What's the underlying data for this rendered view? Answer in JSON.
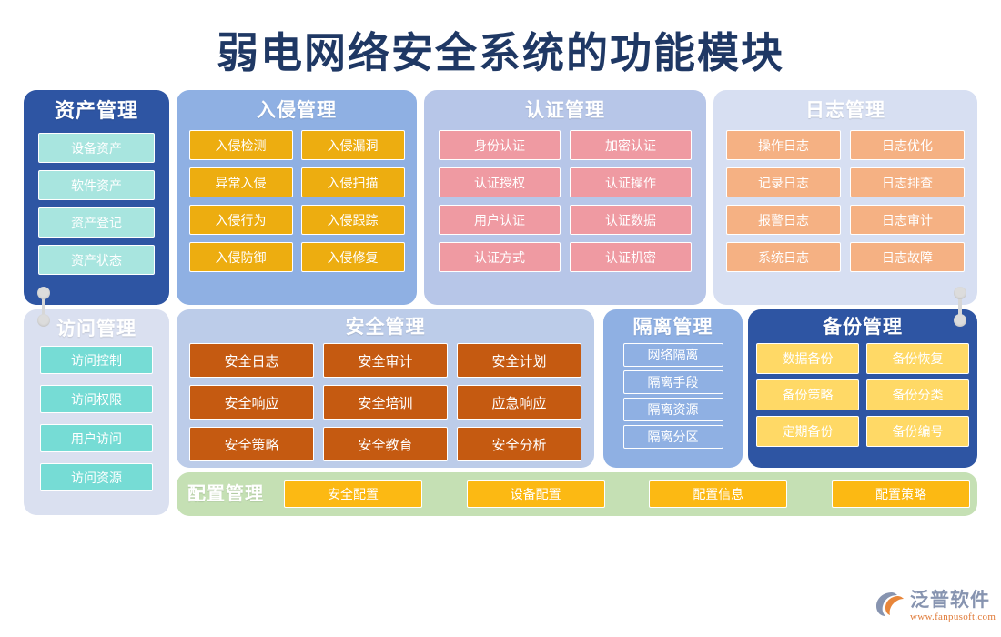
{
  "title": "弱电网络安全系统的功能模块",
  "colors": {
    "title_text": "#1f3864",
    "panel_dark_blue": "#2e55a3",
    "panel_medium_blue": "#8fb0e3",
    "panel_light_blue": "#b7c6e8",
    "panel_pale_blue": "#d7dff2",
    "panel_lavender": "#dae0f0",
    "panel_soft_blue": "#bccce9",
    "panel_green": "#c5e0b4",
    "item_teal_pale": "#a8e5df",
    "item_gold": "#edad10",
    "item_pink": "#ef9aa2",
    "item_orange": "#f5b183",
    "item_turquoise": "#76dcd5",
    "item_brown_orange": "#c55a11",
    "item_yellow": "#ffd966",
    "item_amber": "#fcb913",
    "connector_grey": "#dcdcdc"
  },
  "panels": [
    {
      "id": "asset",
      "title": "资产管理",
      "items": [
        "设备资产",
        "软件资产",
        "资产登记",
        "资产状态"
      ]
    },
    {
      "id": "intrusion",
      "title": "入侵管理",
      "items": [
        "入侵检测",
        "入侵漏洞",
        "异常入侵",
        "入侵扫描",
        "入侵行为",
        "入侵跟踪",
        "入侵防御",
        "入侵修复"
      ]
    },
    {
      "id": "auth",
      "title": "认证管理",
      "items": [
        "身份认证",
        "加密认证",
        "认证授权",
        "认证操作",
        "用户认证",
        "认证数据",
        "认证方式",
        "认证机密"
      ]
    },
    {
      "id": "log",
      "title": "日志管理",
      "items": [
        "操作日志",
        "日志优化",
        "记录日志",
        "日志排查",
        "报警日志",
        "日志审计",
        "系统日志",
        "日志故障"
      ]
    },
    {
      "id": "access",
      "title": "访问管理",
      "items": [
        "访问控制",
        "访问权限",
        "用户访问",
        "访问资源"
      ]
    },
    {
      "id": "security",
      "title": "安全管理",
      "items": [
        "安全日志",
        "安全审计",
        "安全计划",
        "安全响应",
        "安全培训",
        "应急响应",
        "安全策略",
        "安全教育",
        "安全分析"
      ]
    },
    {
      "id": "isolate",
      "title": "隔离管理",
      "items": [
        "网络隔离",
        "隔离手段",
        "隔离资源",
        "隔离分区"
      ]
    },
    {
      "id": "backup",
      "title": "备份管理",
      "items": [
        "数据备份",
        "备份恢复",
        "备份策略",
        "备份分类",
        "定期备份",
        "备份编号"
      ]
    },
    {
      "id": "config",
      "title": "配置管理",
      "items": [
        "安全配置",
        "设备配置",
        "配置信息",
        "配置策略"
      ]
    }
  ],
  "logo": {
    "name": "泛普软件",
    "url": "www.fanpusoft.com"
  }
}
